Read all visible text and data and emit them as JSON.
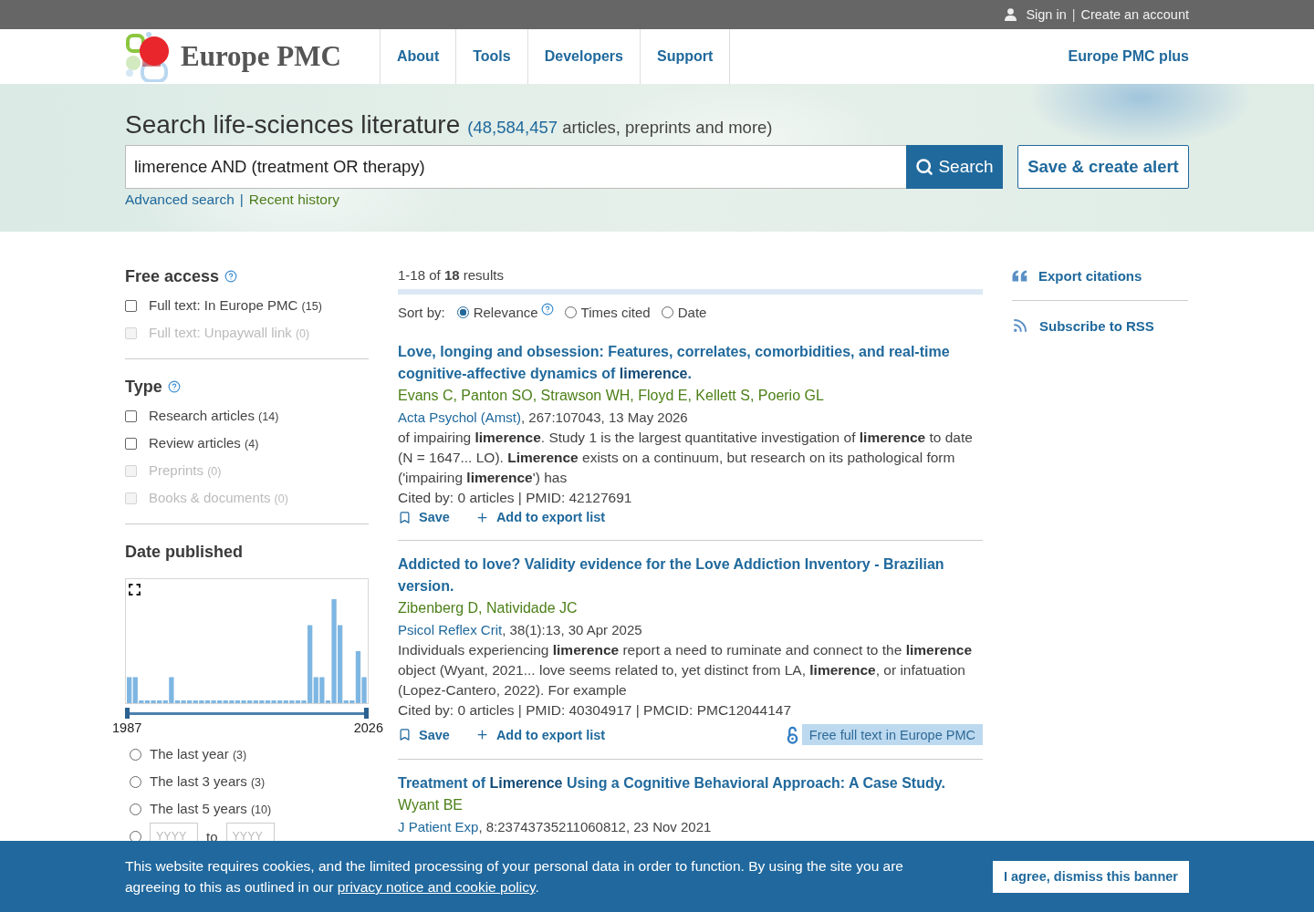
{
  "top_bar": {
    "user_links": [
      {
        "label": "Sign in"
      },
      {
        "label": "Create an account"
      }
    ],
    "separator": "|"
  },
  "header": {
    "logo_text": "Europe PMC",
    "nav": [
      {
        "label": "About"
      },
      {
        "label": "Tools"
      },
      {
        "label": "Developers"
      },
      {
        "label": "Support"
      }
    ],
    "plus_link": "Europe PMC plus"
  },
  "search": {
    "heading": "Search life-sciences literature",
    "count": "(48,584,457",
    "count_text": "articles, preprints and more)",
    "query": "limerence AND (treatment OR therapy)",
    "search_button": "Search",
    "alert_button": "Save & create alert",
    "links": [
      {
        "label": "Advanced search",
        "visited": false
      },
      {
        "label": "Recent history",
        "visited": true
      }
    ],
    "separator": "|"
  },
  "filters": [
    {
      "kind": "checkboxes",
      "title": "Free access",
      "help": true,
      "options": [
        {
          "label": "Full text: In Europe PMC",
          "count": "(15)",
          "checked": false,
          "disabled": false
        },
        {
          "label": "Full text: Unpaywall link",
          "count": "(0)",
          "checked": false,
          "disabled": true
        }
      ]
    },
    {
      "kind": "checkboxes",
      "title": "Type",
      "help": true,
      "options": [
        {
          "label": "Research articles",
          "count": "(14)",
          "checked": false,
          "disabled": false
        },
        {
          "label": "Review articles",
          "count": "(4)",
          "checked": false,
          "disabled": false
        },
        {
          "label": "Preprints",
          "count": "(0)",
          "checked": false,
          "disabled": true
        },
        {
          "label": "Books & documents",
          "count": "(0)",
          "checked": false,
          "disabled": true
        }
      ]
    },
    {
      "kind": "dates",
      "title": "Date published",
      "help": false,
      "histogram": {
        "start_label": "1987",
        "end_label": "2026"
      },
      "slider": {
        "level": 1
      },
      "options": [
        {
          "label": "The last year",
          "count": "(3)",
          "selected": false
        },
        {
          "label": "The last 3 years",
          "count": "(3)",
          "selected": false
        },
        {
          "label": "The last 5 years",
          "count": "(10)",
          "selected": false
        }
      ],
      "custom_range": {
        "selected": false,
        "from_placeholder": "YYYY",
        "to_label": "to",
        "to_placeholder": "YYYY"
      }
    }
  ],
  "results_summary": "1-18 of **18** results",
  "sort": {
    "label": "Sort by:",
    "options": [
      {
        "label": "Relevance",
        "selected": true,
        "help": true
      },
      {
        "label": "Times cited",
        "selected": false,
        "help": false
      },
      {
        "label": "Date",
        "selected": false,
        "help": false
      }
    ]
  },
  "results": [
    {
      "title": "Love, longing and obsession: Features, correlates, comorbidities, and real-time cognitive-affective dynamics of **limerence**.",
      "authors": "Evans C, Panton SO, Strawson WH, Floyd E, Kellett S, Poerio GL",
      "journal": "Acta Psychol (Amst)",
      "citation": ", 267:107043, 13 May 2026",
      "snippet": "of impairing **limerence**. Study 1 is the largest quantitative investigation of **limerence** to date (N = 1647... LO). **Limerence** exists on a continuum, but research on its pathological form ('impairing **limerence**') has",
      "meta": "Cited by: 0 articles | PMID: 42127691",
      "actions": [
        {
          "kind": "save",
          "label": "Save"
        },
        {
          "kind": "export",
          "label": "Add to export list"
        }
      ]
    },
    {
      "title": "Addicted to love? Validity evidence for the Love Addiction Inventory - Brazilian version.",
      "authors": "Zibenberg D, Natividade JC",
      "journal": "Psicol Reflex Crit",
      "citation": ", 38(1):13, 30 Apr 2025",
      "snippet": "Individuals experiencing **limerence** report a need to ruminate and connect to the **limerence** object (Wyant, 2021... love seems related to, yet distinct from LA, **limerence**, or infatuation (Lopez-Cantero, 2022). For example",
      "meta": "Cited by: 0 articles | PMID: 40304917 | PMCID: PMC12044147",
      "actions": [
        {
          "kind": "save",
          "label": "Save"
        },
        {
          "kind": "export",
          "label": "Add to export list"
        }
      ],
      "free_full_text": "Free full text in Europe PMC"
    },
    {
      "title": "Treatment of **Limerence** Using a Cognitive Behavioral Approach: A Case Study.",
      "authors": "Wyant BE",
      "journal": "J Patient Exp",
      "citation": ", 8:23743735211060812, 23 Nov 2021"
    }
  ],
  "side_links": [
    {
      "kind": "export",
      "label": "Export citations"
    },
    {
      "kind": "rss",
      "label": "Subscribe to RSS"
    }
  ],
  "cookie_banner": {
    "text": "This website requires cookies, and the limited processing of your personal data in order to function. By using the site you are agreeing to this as outlined in our",
    "link": "privacy notice and cookie policy",
    "end": ".",
    "button": "I agree, dismiss this banner"
  }
}
